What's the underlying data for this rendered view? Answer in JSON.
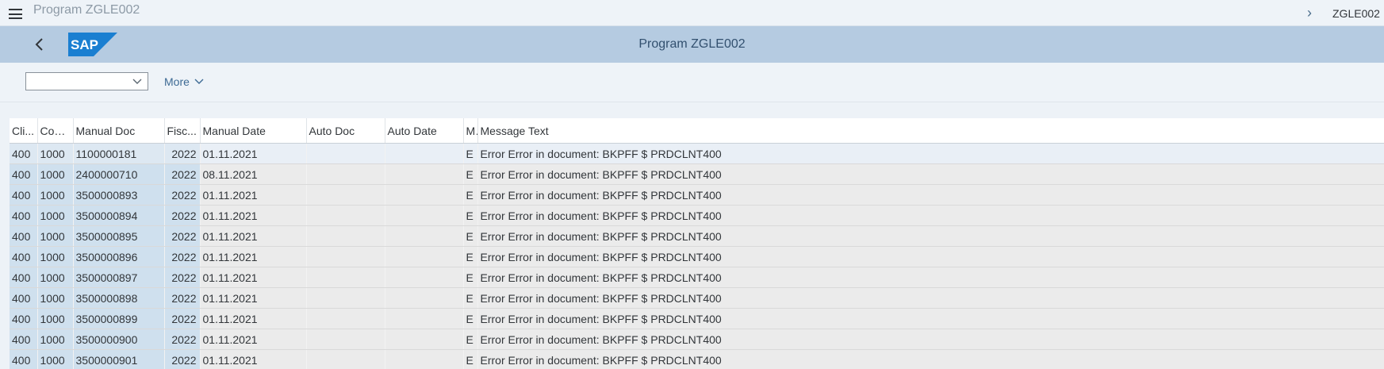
{
  "topbar": {
    "title": "Program ZGLE002",
    "tcode": "ZGLE002"
  },
  "shell": {
    "logo_text": "SAP",
    "title": "Program ZGLE002"
  },
  "toolbar": {
    "variant_value": "",
    "more_label": "More"
  },
  "table": {
    "columns": [
      "Cli...",
      "CoC...",
      "Manual Doc",
      "Fisc...",
      "Manual Date",
      "Auto Doc",
      "Auto Date",
      "Ms",
      "Message Text"
    ],
    "rows": [
      [
        "400",
        "1000",
        "1100000181",
        "2022",
        "01.11.2021",
        "",
        "",
        "E",
        "Error Error in document: BKPFF $ PRDCLNT400"
      ],
      [
        "400",
        "1000",
        "2400000710",
        "2022",
        "08.11.2021",
        "",
        "",
        "E",
        "Error Error in document: BKPFF $ PRDCLNT400"
      ],
      [
        "400",
        "1000",
        "3500000893",
        "2022",
        "01.11.2021",
        "",
        "",
        "E",
        "Error Error in document: BKPFF $ PRDCLNT400"
      ],
      [
        "400",
        "1000",
        "3500000894",
        "2022",
        "01.11.2021",
        "",
        "",
        "E",
        "Error Error in document: BKPFF $ PRDCLNT400"
      ],
      [
        "400",
        "1000",
        "3500000895",
        "2022",
        "01.11.2021",
        "",
        "",
        "E",
        "Error Error in document: BKPFF $ PRDCLNT400"
      ],
      [
        "400",
        "1000",
        "3500000896",
        "2022",
        "01.11.2021",
        "",
        "",
        "E",
        "Error Error in document: BKPFF $ PRDCLNT400"
      ],
      [
        "400",
        "1000",
        "3500000897",
        "2022",
        "01.11.2021",
        "",
        "",
        "E",
        "Error Error in document: BKPFF $ PRDCLNT400"
      ],
      [
        "400",
        "1000",
        "3500000898",
        "2022",
        "01.11.2021",
        "",
        "",
        "E",
        "Error Error in document: BKPFF $ PRDCLNT400"
      ],
      [
        "400",
        "1000",
        "3500000899",
        "2022",
        "01.11.2021",
        "",
        "",
        "E",
        "Error Error in document: BKPFF $ PRDCLNT400"
      ],
      [
        "400",
        "1000",
        "3500000900",
        "2022",
        "01.11.2021",
        "",
        "",
        "E",
        "Error Error in document: BKPFF $ PRDCLNT400"
      ],
      [
        "400",
        "1000",
        "3500000901",
        "2022",
        "01.11.2021",
        "",
        "",
        "E",
        "Error Error in document: BKPFF $ PRDCLNT400"
      ]
    ]
  },
  "colors": {
    "shell_bg": "#b5cbe1",
    "logo_blue": "#1a7fd1",
    "link": "#3d6a94",
    "key_cell": "#cfe0ee"
  }
}
